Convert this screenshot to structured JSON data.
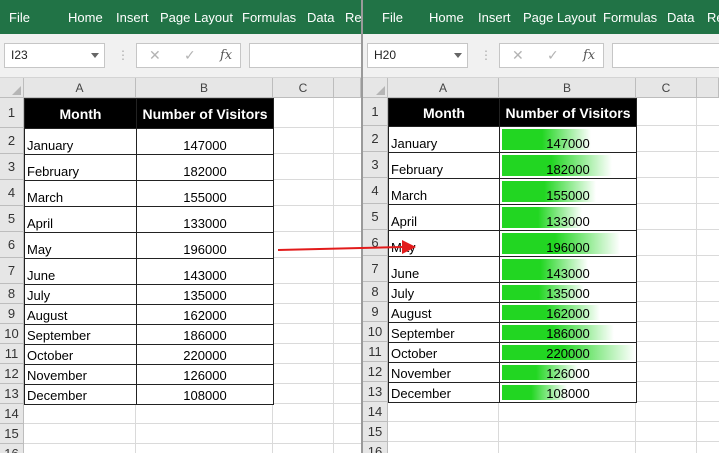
{
  "ribbon_tabs": [
    "File",
    "Home",
    "Insert",
    "Page Layout",
    "Formulas",
    "Data",
    "Re"
  ],
  "left": {
    "name_box": "I23",
    "columns": [
      "A",
      "B",
      "C"
    ],
    "rows": [
      "1",
      "2",
      "3",
      "4",
      "5",
      "6",
      "7",
      "8",
      "9",
      "10",
      "11",
      "12",
      "13",
      "14",
      "15",
      "16"
    ]
  },
  "right": {
    "name_box": "H20",
    "columns": [
      "A",
      "B",
      "C"
    ],
    "rows": [
      "1",
      "2",
      "3",
      "4",
      "5",
      "6",
      "7",
      "8",
      "9",
      "10",
      "11",
      "12",
      "13",
      "14",
      "15",
      "16"
    ]
  },
  "formula_buttons": {
    "cancel": "✕",
    "enter": "✓",
    "fx": "fx"
  },
  "table": {
    "header_month": "Month",
    "header_visitors": "Number of Visitors",
    "rows": [
      {
        "month": "January",
        "visitors": "147000"
      },
      {
        "month": "February",
        "visitors": "182000"
      },
      {
        "month": "March",
        "visitors": "155000"
      },
      {
        "month": "April",
        "visitors": "133000"
      },
      {
        "month": "May",
        "visitors": "196000"
      },
      {
        "month": "June",
        "visitors": "143000"
      },
      {
        "month": "July",
        "visitors": "135000"
      },
      {
        "month": "August",
        "visitors": "162000"
      },
      {
        "month": "September",
        "visitors": "186000"
      },
      {
        "month": "October",
        "visitors": "220000"
      },
      {
        "month": "November",
        "visitors": "126000"
      },
      {
        "month": "December",
        "visitors": "108000"
      }
    ]
  },
  "data_bars": {
    "color": "#22d622",
    "min": 0,
    "max": 220000
  },
  "colors": {
    "ribbon": "#217346",
    "arrow": "#e21b1b",
    "header_cell": "#000000"
  }
}
